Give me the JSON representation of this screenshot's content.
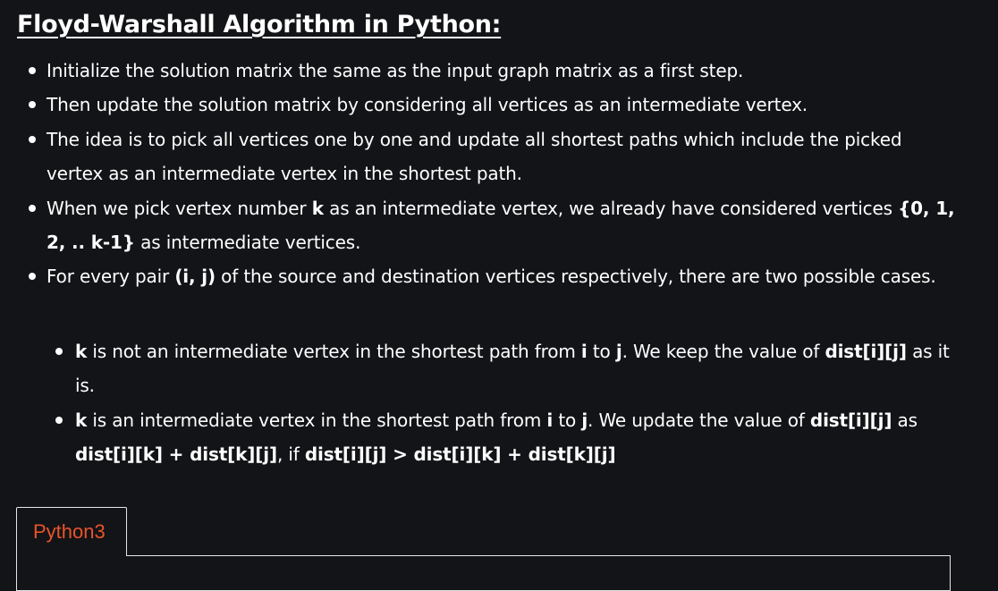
{
  "article": {
    "title": "Floyd-Warshall Algorithm in Python:",
    "bullets": [
      {
        "text": "Initialize the solution matrix the same as the input graph matrix as a first step."
      },
      {
        "text": "Then update the solution matrix by considering all vertices as an intermediate vertex."
      },
      {
        "text": "The idea is to pick all vertices one by one and update all shortest paths which include the picked vertex as an intermediate vertex in the shortest path."
      },
      {
        "p1": "When we pick vertex number ",
        "b1": "k",
        "p2": " as an intermediate vertex, we already have considered vertices ",
        "b2": "{0, 1, 2, .. k-1}",
        "p3": " as intermediate vertices."
      },
      {
        "p1": "For every pair ",
        "b1": "(i, j)",
        "p2": " of the source and destination vertices respectively, there are two possible cases."
      }
    ],
    "sub_bullets": [
      {
        "b1": "k",
        "p1": " is not an intermediate vertex in the shortest path from ",
        "b2": "i",
        "p2": " to ",
        "b3": "j",
        "p3": ". We keep the value of ",
        "b4": "dist[i][j]",
        "p4": " as it is."
      },
      {
        "b1": "k",
        "p1": " is an intermediate vertex in the shortest path from ",
        "b2": "i",
        "p2": " to ",
        "b3": "j",
        "p3": ". We update the value of ",
        "b4": "dist[i][j]",
        "p4": " as ",
        "b5": "dist[i][k] + dist[k][j]",
        "p5": ", if ",
        "b6": "dist[i][j] > dist[i][k] + dist[k][j]"
      }
    ]
  },
  "code_tabs": {
    "active_tab": "Python3"
  }
}
